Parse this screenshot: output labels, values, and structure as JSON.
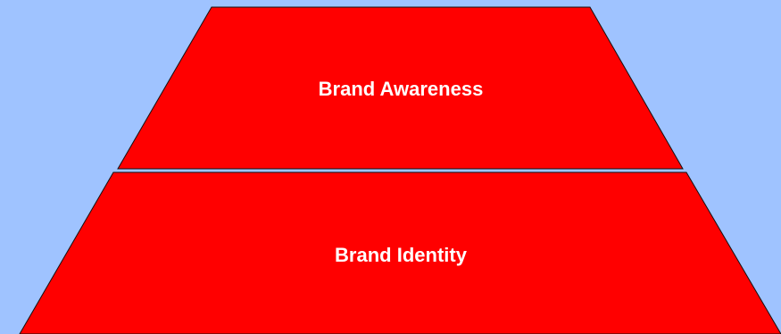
{
  "diagram": {
    "background_color": "#9fc3ff",
    "segment_color": "#ff0000",
    "outline_color": "#111111",
    "levels": [
      {
        "label": "Brand Awareness"
      },
      {
        "label": "Brand Identity"
      }
    ]
  }
}
